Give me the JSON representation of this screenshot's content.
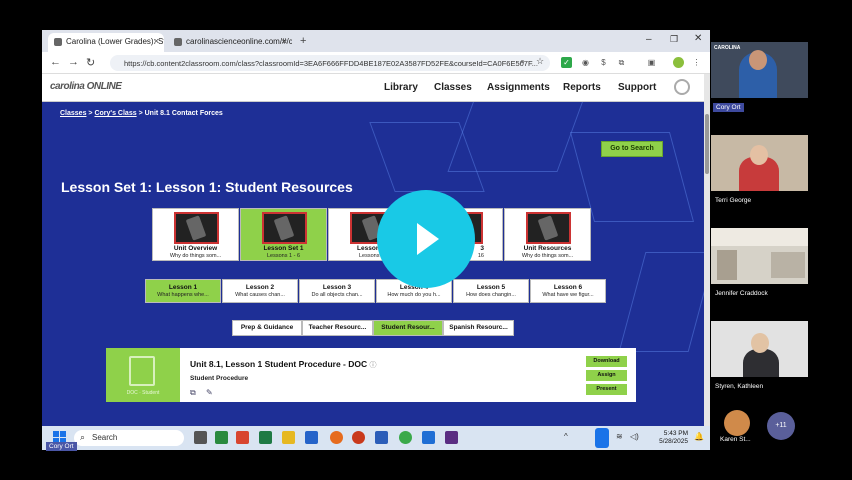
{
  "browser": {
    "tabs": [
      {
        "label": "Carolina (Lower Grades): Stude"
      },
      {
        "label": "carolinascienceonline.com/#/c"
      }
    ],
    "new_tab": "+",
    "url": "https://cb.content2classroom.com/class?classroomId=3EA6F666FFDD4BE187E02A3587FD52FE&courseId=CA0F6E507F..."
  },
  "site": {
    "logo": "carolina ONLINE",
    "nav": [
      "Library",
      "Classes",
      "Assignments",
      "Reports",
      "Support"
    ]
  },
  "breadcrumb": {
    "items": [
      "Classes",
      "Cory's Class",
      "Unit 8.1 Contact Forces"
    ],
    "separator": ">"
  },
  "go_to_search": "Go to Search",
  "lesson_title": "Lesson Set 1: Lesson 1: Student Resources",
  "cards": [
    {
      "title": "Unit Overview",
      "subtitle": "Why do things som..."
    },
    {
      "title": "Lesson Set 1",
      "subtitle": "Lessons 1 - 6"
    },
    {
      "title": "Lesson S",
      "subtitle": "Lessons 7"
    },
    {
      "title": "3",
      "subtitle": "16"
    },
    {
      "title": "Unit Resources",
      "subtitle": "Why do things som..."
    }
  ],
  "lesson_tabs": [
    {
      "title": "Lesson 1",
      "subtitle": "What happens whe..."
    },
    {
      "title": "Lesson 2",
      "subtitle": "What causes chan..."
    },
    {
      "title": "Lesson 3",
      "subtitle": "Do all objects chan..."
    },
    {
      "title": "Lesson 4",
      "subtitle": "How much do you h..."
    },
    {
      "title": "Lesson 5",
      "subtitle": "How does changin..."
    },
    {
      "title": "Lesson 6",
      "subtitle": "What have we figur..."
    }
  ],
  "resource_tabs": [
    "Prep & Guidance",
    "Teacher Resourc...",
    "Student Resour...",
    "Spanish Resourc..."
  ],
  "resource": {
    "title": "Unit 8.1, Lesson 1 Student Procedure - DOC",
    "info": "ⓘ",
    "subtitle": "Student Procedure",
    "icon_label": "DOC · Student",
    "buttons": [
      "Download",
      "Assign",
      "Present"
    ]
  },
  "taskbar": {
    "search_placeholder": "Search",
    "time": "5:43 PM",
    "date": "5/28/2025"
  },
  "participants": [
    {
      "name": "Cory Ort"
    },
    {
      "name": "Terri George"
    },
    {
      "name": "Jennifer Craddock"
    },
    {
      "name": "Styren, Kathleen"
    },
    {
      "name": "Karen St..."
    }
  ],
  "more_participants": "+11",
  "self_label": "Cory Ort",
  "colors": {
    "accent_green": "#8fd14a",
    "page_blue": "#1e2f96",
    "play": "#19c9e6"
  }
}
